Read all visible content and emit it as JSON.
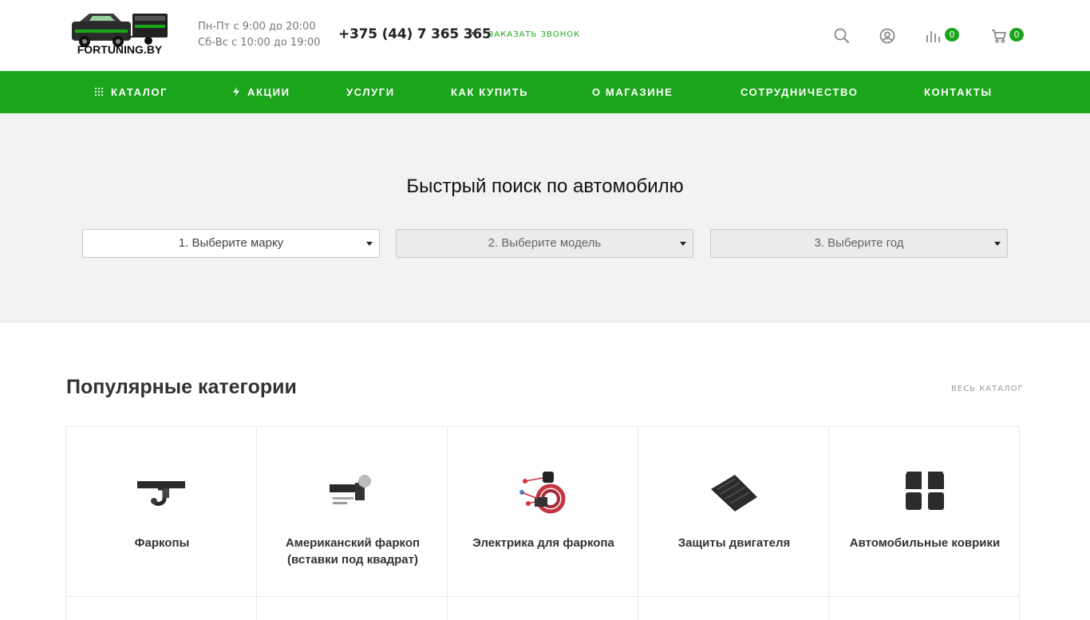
{
  "header": {
    "logo_text": "FORTUNING.BY",
    "hours_weekdays": "Пн-Пт с 9:00 до 20:00",
    "hours_weekend": "Сб-Вс с 10:00 до 19:00",
    "phone": "+375 (44) 7 365 365",
    "callback_label": "Заказать звонок",
    "compare_count": "0",
    "cart_count": "0",
    "icons": [
      "search-icon",
      "user-icon",
      "compare-icon",
      "cart-icon"
    ]
  },
  "nav": {
    "items": [
      {
        "label": "Каталог",
        "icon": "grid-icon"
      },
      {
        "label": "Акции",
        "icon": "lightning-icon"
      },
      {
        "label": "Услуги"
      },
      {
        "label": "Как купить"
      },
      {
        "label": "О магазине"
      },
      {
        "label": "Сотрудничество"
      },
      {
        "label": "Контакты"
      }
    ]
  },
  "search": {
    "title": "Быстрый поиск по автомобилю",
    "selects": [
      {
        "value": "1. Выберите марку",
        "state": "enabled"
      },
      {
        "value": "2. Выберите модель",
        "state": "disabled"
      },
      {
        "value": "3. Выберите год",
        "state": "disabled"
      }
    ]
  },
  "categories": {
    "title": "Популярные категории",
    "all_link": "Весь каталог",
    "items": [
      {
        "label": "Фаркопы",
        "icon": "towbar-icon"
      },
      {
        "label": "Американский фаркоп (вставки под квадрат)",
        "icon": "hitch-insert-icon"
      },
      {
        "label": "Электрика для фаркопа",
        "icon": "wiring-kit-icon"
      },
      {
        "label": "Защиты двигателя",
        "icon": "engine-guard-icon"
      },
      {
        "label": "Автомобильные коврики",
        "icon": "car-mats-icon"
      }
    ]
  },
  "colors": {
    "accent_green": "#1ba51b",
    "band_gray": "#f2f2f2"
  }
}
